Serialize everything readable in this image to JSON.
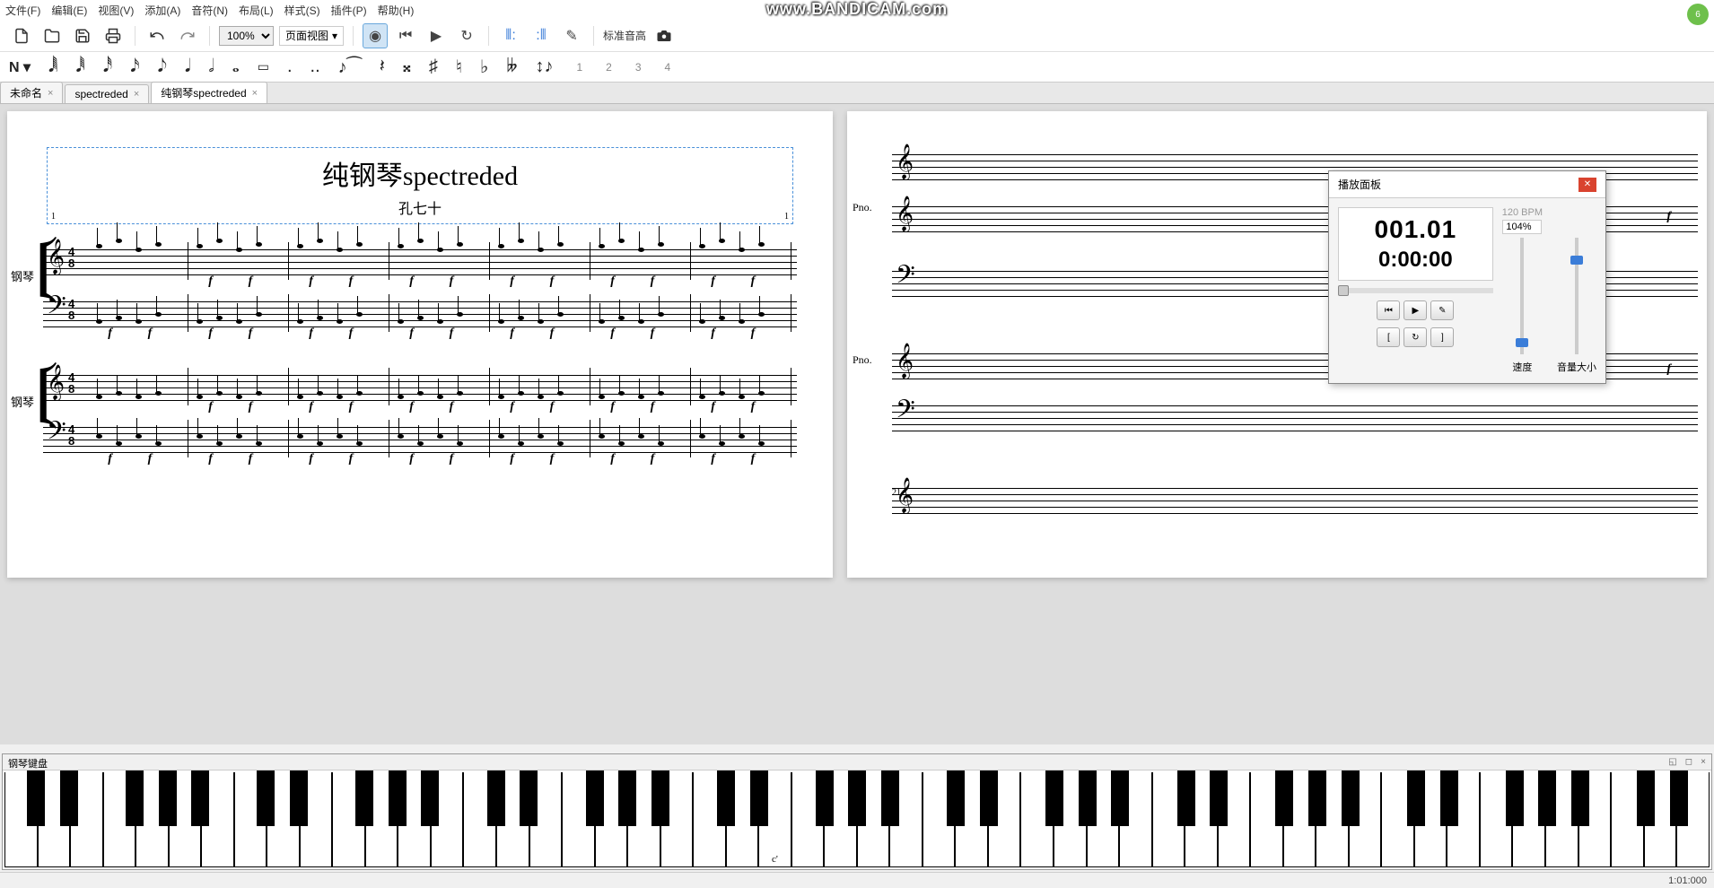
{
  "watermark": "www.BANDICAM.com",
  "badge": "6",
  "menu": {
    "file": "文件(F)",
    "edit": "编辑(E)",
    "view": "视图(V)",
    "add": "添加(A)",
    "note": "音符(N)",
    "layout": "布局(L)",
    "style": "样式(S)",
    "plugin": "插件(P)",
    "help": "帮助(H)"
  },
  "toolbar": {
    "zoom": "100%",
    "viewmode": "页面视图",
    "pitch": "标准音高"
  },
  "voices": [
    "1",
    "2",
    "3",
    "4"
  ],
  "tabs": [
    {
      "label": "未命名",
      "active": false
    },
    {
      "label": "spectreded",
      "active": false
    },
    {
      "label": "纯钢琴spectreded",
      "active": true
    }
  ],
  "score": {
    "title": "纯钢琴spectreded",
    "subtitle": "孔七十",
    "line_left": "1",
    "line_right": "1",
    "instr1": "钢琴",
    "instr2": "钢琴",
    "time_top": "4",
    "time_bot": "8",
    "dyn": "f",
    "page2_instr": "Pno.",
    "page2_measure": "21"
  },
  "playpanel": {
    "title": "播放面板",
    "pos": "001.01",
    "clock": "0:00:00",
    "bpm": "120 BPM",
    "pct": "104%",
    "speed_label": "速度",
    "volume_label": "音量大小"
  },
  "piano": {
    "title": "钢琴键盘",
    "middle_c": "c'"
  },
  "status": {
    "pos": "1:01:000"
  }
}
